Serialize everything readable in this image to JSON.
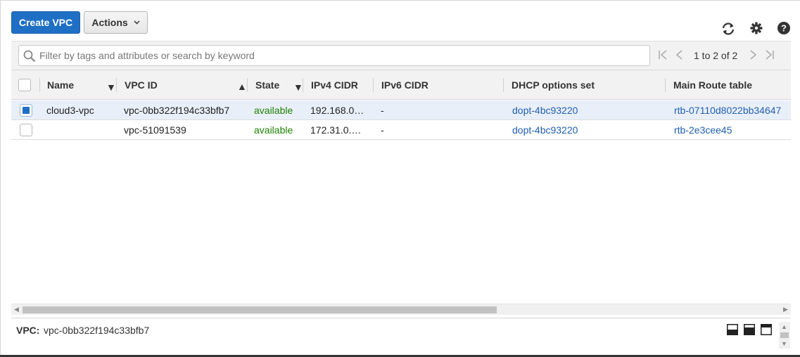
{
  "toolbar": {
    "create_label": "Create VPC",
    "actions_label": "Actions",
    "icons": [
      "refresh-icon",
      "settings-gear-icon",
      "help-icon"
    ]
  },
  "filter": {
    "placeholder": "Filter by tags and attributes or search by keyword",
    "pagination": "1 to 2 of 2"
  },
  "table": {
    "columns": [
      "Name",
      "VPC ID",
      "State",
      "IPv4 CIDR",
      "IPv6 CIDR",
      "DHCP options set",
      "Main Route table"
    ],
    "rows": [
      {
        "selected": true,
        "name": "cloud3-vpc",
        "vpc_id": "vpc-0bb322f194c33bfb7",
        "state": "available",
        "ipv4": "192.168.0…",
        "ipv6": "-",
        "dhcp": "dopt-4bc93220",
        "route_table": "rtb-07110d8022bb34647"
      },
      {
        "selected": false,
        "name": "",
        "vpc_id": "vpc-51091539",
        "state": "available",
        "ipv4": "172.31.0.…",
        "ipv6": "-",
        "dhcp": "dopt-4bc93220",
        "route_table": "rtb-2e3cee45"
      }
    ]
  },
  "details": {
    "label": "VPC:",
    "value": "vpc-0bb322f194c33bfb7"
  },
  "colors": {
    "primary": "#1f6fc5",
    "available": "#1d8102",
    "link": "#1f5fb0",
    "selected_row": "#e9eff8"
  }
}
